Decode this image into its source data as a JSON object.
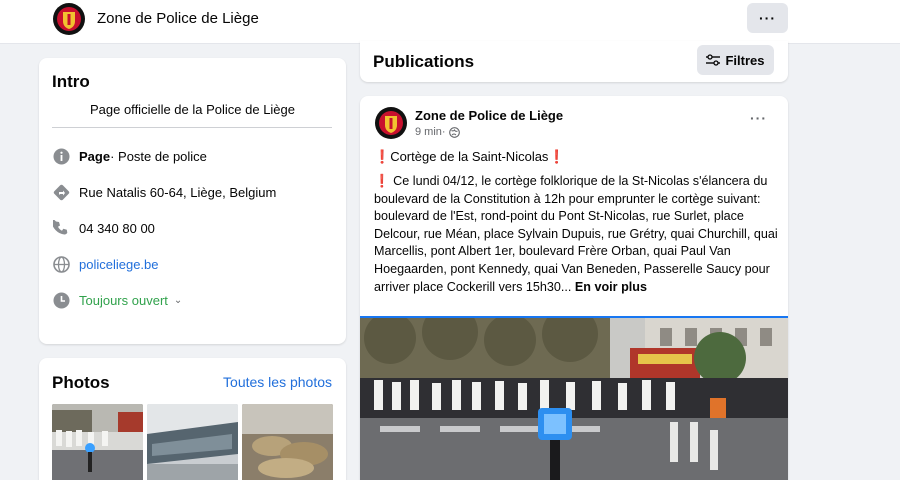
{
  "header": {
    "page_name": "Zone de Police de Liège",
    "more_label": "···"
  },
  "intro": {
    "title": "Intro",
    "description": "Page officielle de la Police de Liège",
    "category_bold": "Page",
    "category_rest": " · Poste de police",
    "address": "Rue Natalis 60-64, Liège, Belgium",
    "phone": "04 340 80 00",
    "website": "policeliege.be",
    "hours": "Toujours ouvert"
  },
  "photos": {
    "title": "Photos",
    "see_all": "Toutes les photos"
  },
  "publications": {
    "title": "Publications",
    "filters_label": "Filtres"
  },
  "post": {
    "author": "Zone de Police de Liège",
    "time": "9 min",
    "separator": " · ",
    "more_label": "···",
    "headline_mark": "❗",
    "headline": "Cortège de la Saint-Nicolas",
    "body_mark": "❗",
    "body": " Ce lundi 04/12, le cortège folklorique de la St-Nicolas s'élancera du boulevard de la Constitution à 12h pour emprunter le cortège suivant: boulevard de l'Est, rond-point du Pont St-Nicolas, rue Surlet, place Delcour, rue Méan, place Sylvain Dupuis, rue Grétry, quai Churchill, quai Marcellis, pont Albert 1er, boulevard Frère Orban, quai Paul Van Hoegaarden, pont Kennedy, quai Van Beneden, Passerelle Saucy pour arriver place Cockerill vers 15h30...",
    "see_more": "En voir plus"
  },
  "colors": {
    "link": "#216fdb",
    "open_green": "#31a24c",
    "bg": "#f0f2f5"
  }
}
